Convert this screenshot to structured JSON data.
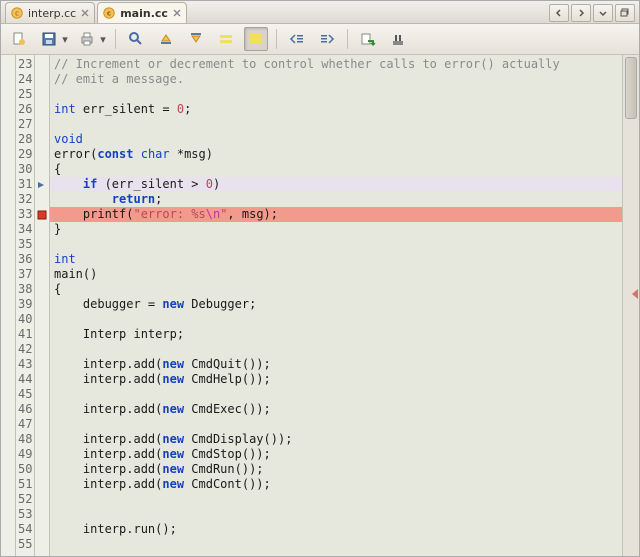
{
  "tabs": [
    {
      "label": "interp.cc",
      "active": false
    },
    {
      "label": "main.cc",
      "active": true
    }
  ],
  "lines": [
    {
      "n": 23,
      "mark": "",
      "tokens": [
        {
          "t": "// Increment or decrement to control whether calls to error() actually",
          "c": "c-comment"
        }
      ]
    },
    {
      "n": 24,
      "mark": "",
      "tokens": [
        {
          "t": "// emit a message.",
          "c": "c-comment"
        }
      ]
    },
    {
      "n": 25,
      "mark": "",
      "tokens": []
    },
    {
      "n": 26,
      "mark": "",
      "tokens": [
        {
          "t": "int",
          "c": "c-type"
        },
        {
          "t": " err_silent = ",
          "c": ""
        },
        {
          "t": "0",
          "c": "c-num"
        },
        {
          "t": ";",
          "c": ""
        }
      ]
    },
    {
      "n": 27,
      "mark": "",
      "tokens": []
    },
    {
      "n": 28,
      "mark": "",
      "tokens": [
        {
          "t": "void",
          "c": "c-type"
        }
      ]
    },
    {
      "n": 29,
      "mark": "",
      "tokens": [
        {
          "t": "error(",
          "c": ""
        },
        {
          "t": "const",
          "c": "c-kw"
        },
        {
          "t": " ",
          "c": ""
        },
        {
          "t": "char",
          "c": "c-type"
        },
        {
          "t": " *msg)",
          "c": ""
        }
      ]
    },
    {
      "n": 30,
      "mark": "",
      "tokens": [
        {
          "t": "{",
          "c": ""
        }
      ]
    },
    {
      "n": 31,
      "mark": "cur",
      "tokens": [
        {
          "t": "    ",
          "c": ""
        },
        {
          "t": "if",
          "c": "c-kw"
        },
        {
          "t": " (err_silent > ",
          "c": ""
        },
        {
          "t": "0",
          "c": "c-num"
        },
        {
          "t": ")",
          "c": ""
        }
      ]
    },
    {
      "n": 32,
      "mark": "",
      "tokens": [
        {
          "t": "        ",
          "c": ""
        },
        {
          "t": "return",
          "c": "c-kw"
        },
        {
          "t": ";",
          "c": ""
        }
      ]
    },
    {
      "n": 33,
      "mark": "bp",
      "tokens": [
        {
          "t": "    printf(",
          "c": ""
        },
        {
          "t": "\"error: %s",
          "c": "c-str"
        },
        {
          "t": "\\n",
          "c": "c-esc"
        },
        {
          "t": "\"",
          "c": "c-str"
        },
        {
          "t": ", msg);",
          "c": ""
        }
      ]
    },
    {
      "n": 34,
      "mark": "",
      "tokens": [
        {
          "t": "}",
          "c": ""
        }
      ]
    },
    {
      "n": 35,
      "mark": "",
      "tokens": []
    },
    {
      "n": 36,
      "mark": "",
      "tokens": [
        {
          "t": "int",
          "c": "c-type"
        }
      ]
    },
    {
      "n": 37,
      "mark": "",
      "tokens": [
        {
          "t": "main()",
          "c": ""
        }
      ]
    },
    {
      "n": 38,
      "mark": "",
      "tokens": [
        {
          "t": "{",
          "c": ""
        }
      ]
    },
    {
      "n": 39,
      "mark": "",
      "tokens": [
        {
          "t": "    debugger = ",
          "c": ""
        },
        {
          "t": "new",
          "c": "c-kw"
        },
        {
          "t": " Debugger;",
          "c": ""
        }
      ]
    },
    {
      "n": 40,
      "mark": "",
      "tokens": []
    },
    {
      "n": 41,
      "mark": "",
      "tokens": [
        {
          "t": "    Interp interp;",
          "c": ""
        }
      ]
    },
    {
      "n": 42,
      "mark": "",
      "tokens": []
    },
    {
      "n": 43,
      "mark": "",
      "tokens": [
        {
          "t": "    interp.add(",
          "c": ""
        },
        {
          "t": "new",
          "c": "c-kw"
        },
        {
          "t": " CmdQuit());",
          "c": ""
        }
      ]
    },
    {
      "n": 44,
      "mark": "",
      "tokens": [
        {
          "t": "    interp.add(",
          "c": ""
        },
        {
          "t": "new",
          "c": "c-kw"
        },
        {
          "t": " CmdHelp());",
          "c": ""
        }
      ]
    },
    {
      "n": 45,
      "mark": "",
      "tokens": []
    },
    {
      "n": 46,
      "mark": "",
      "tokens": [
        {
          "t": "    interp.add(",
          "c": ""
        },
        {
          "t": "new",
          "c": "c-kw"
        },
        {
          "t": " CmdExec());",
          "c": ""
        }
      ]
    },
    {
      "n": 47,
      "mark": "",
      "tokens": []
    },
    {
      "n": 48,
      "mark": "",
      "tokens": [
        {
          "t": "    interp.add(",
          "c": ""
        },
        {
          "t": "new",
          "c": "c-kw"
        },
        {
          "t": " CmdDisplay());",
          "c": ""
        }
      ]
    },
    {
      "n": 49,
      "mark": "",
      "tokens": [
        {
          "t": "    interp.add(",
          "c": ""
        },
        {
          "t": "new",
          "c": "c-kw"
        },
        {
          "t": " CmdStop());",
          "c": ""
        }
      ]
    },
    {
      "n": 50,
      "mark": "",
      "tokens": [
        {
          "t": "    interp.add(",
          "c": ""
        },
        {
          "t": "new",
          "c": "c-kw"
        },
        {
          "t": " CmdRun());",
          "c": ""
        }
      ]
    },
    {
      "n": 51,
      "mark": "",
      "tokens": [
        {
          "t": "    interp.add(",
          "c": ""
        },
        {
          "t": "new",
          "c": "c-kw"
        },
        {
          "t": " CmdCont());",
          "c": ""
        }
      ]
    },
    {
      "n": 52,
      "mark": "",
      "tokens": []
    },
    {
      "n": 53,
      "mark": "",
      "tokens": []
    },
    {
      "n": 54,
      "mark": "",
      "tokens": [
        {
          "t": "    interp.run();",
          "c": ""
        }
      ]
    },
    {
      "n": 55,
      "mark": "",
      "tokens": []
    }
  ]
}
